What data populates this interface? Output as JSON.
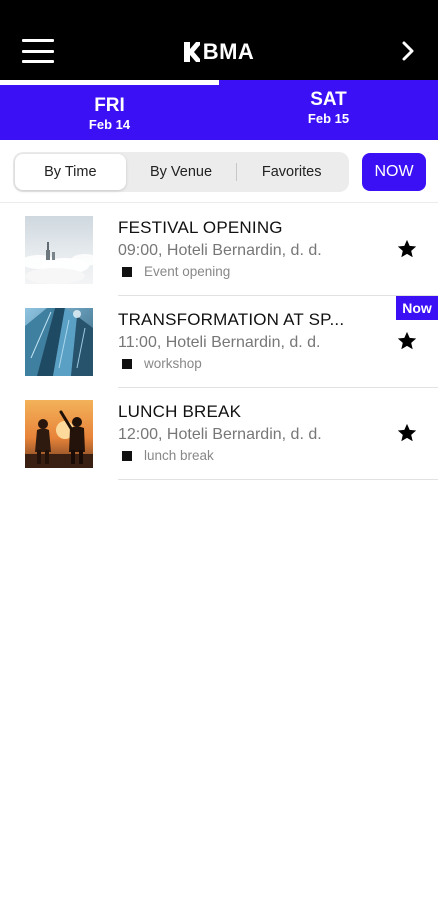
{
  "header": {
    "logo_text": "BMA"
  },
  "days": [
    {
      "name": "FRI",
      "date": "Feb 14",
      "active": true
    },
    {
      "name": "SAT",
      "date": "Feb 15",
      "active": false
    }
  ],
  "filters": {
    "options": [
      "By Time",
      "By Venue",
      "Favorites"
    ],
    "selected": "By Time",
    "now_label": "NOW"
  },
  "sessions": [
    {
      "title": "FESTIVAL OPENING",
      "time": "09:00, Hoteli Bernardin, d. d.",
      "category": "Event opening",
      "thumbnail": "clouds-aerial-image",
      "favorite": true
    },
    {
      "title": "TRANSFORMATION AT SP...",
      "time": "11:00, Hoteli Bernardin, d. d.",
      "category": "workshop",
      "thumbnail": "glass-skyscrapers-image",
      "favorite": true,
      "badge": "Now"
    },
    {
      "title": "LUNCH BREAK",
      "time": "12:00, Hoteli Bernardin, d. d.",
      "category": "lunch break",
      "thumbnail": "sunset-people-image",
      "favorite": true
    }
  ],
  "colors": {
    "brand": "#3b10f5",
    "topbar": "#000000",
    "background": "#ffffff"
  },
  "icons": {
    "menu": "hamburger-menu-icon",
    "next": "chevron-right-icon",
    "favorite": "star-icon"
  }
}
